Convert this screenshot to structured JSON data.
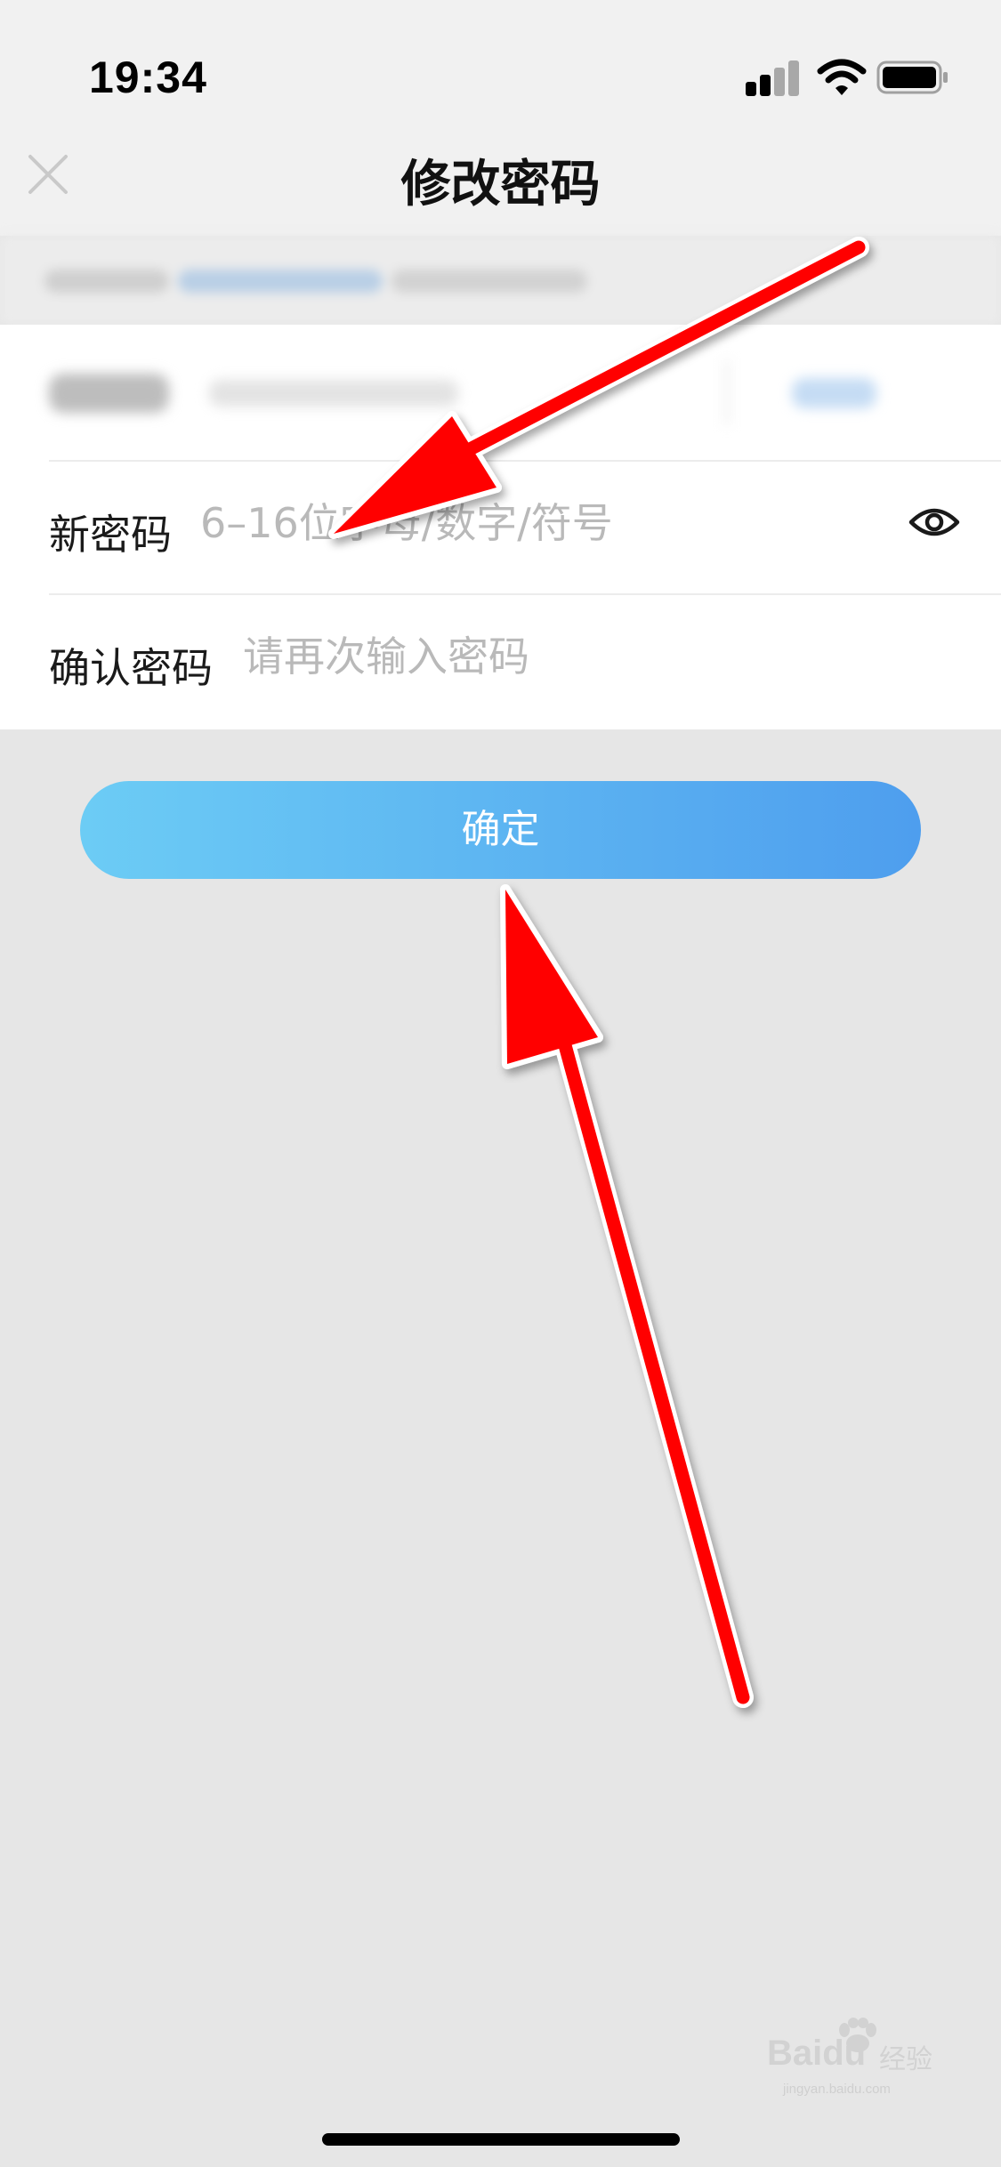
{
  "status_bar": {
    "time": "19:34",
    "icons": [
      "signal-icon",
      "wifi-icon",
      "battery-icon"
    ]
  },
  "nav": {
    "title": "修改密码",
    "close_icon": "close-icon"
  },
  "form": {
    "new_password": {
      "label": "新密码",
      "placeholder": "6–16位字母/数字/符号",
      "value": "",
      "toggle_icon": "eye-icon"
    },
    "confirm_password": {
      "label": "确认密码",
      "placeholder": "请再次输入密码",
      "value": ""
    }
  },
  "confirm_button": {
    "label": "确定"
  },
  "watermark": {
    "brand": "Baidu",
    "brand_cn": "经验",
    "site": "jingyan.baidu.com"
  },
  "colors": {
    "button_gradient_start": "#6cccf5",
    "button_gradient_end": "#4e9eee",
    "page_background": "#e6e6e6",
    "annotation_arrow": "#ff0000"
  }
}
